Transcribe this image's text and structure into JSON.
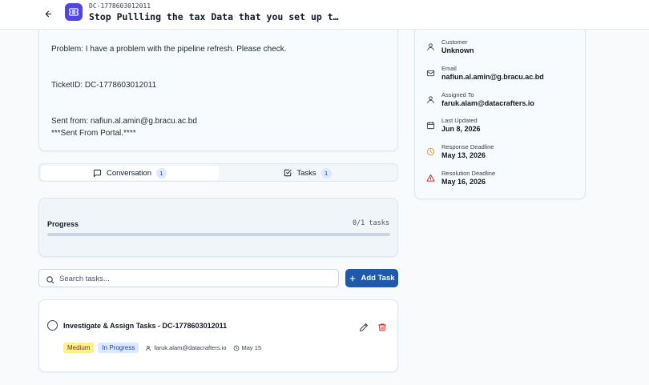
{
  "header": {
    "ticket_id": "DC-1778603012011",
    "title": "Stop Pullling the tax Data that you set up t…"
  },
  "message": {
    "lines": [
      "Problem: I have a problem with the pipeline refresh. Please check.",
      "TicketID: DC-1778603012011",
      "Sent from: nafiun.al.amin@g.bracu.ac.bd",
      "***Sent From Portal.****"
    ]
  },
  "tabs": [
    {
      "label": "Conversation",
      "count": "1",
      "icon": "message-square-icon"
    },
    {
      "label": "Tasks",
      "count": "1",
      "icon": "check-square-icon"
    }
  ],
  "progress": {
    "label": "Progress",
    "count_text": "0/1 tasks",
    "fraction": 0
  },
  "search": {
    "placeholder": "Search tasks...",
    "value": ""
  },
  "add_task": {
    "label": "Add Task"
  },
  "tasks": [
    {
      "title": "Investigate & Assign Tasks - DC-1778603012011",
      "priority": "Medium",
      "status": "In Progress",
      "assignee": "faruk.alam@datacrafters.io",
      "due": "May 15"
    }
  ],
  "details": [
    {
      "label": "Customer",
      "value": "Unknown",
      "icon": "user-icon"
    },
    {
      "label": "Email",
      "value": "nafiun.al.amin@g.bracu.ac.bd",
      "icon": "mail-icon"
    },
    {
      "label": "Assigned To",
      "value": "faruk.alam@datacrafters.io",
      "icon": "user-icon"
    },
    {
      "label": "Last Updated",
      "value": "Jun 8, 2026",
      "icon": "calendar-icon"
    },
    {
      "label": "Response Deadline",
      "value": "May 13, 2026",
      "icon": "clock-icon"
    },
    {
      "label": "Resolution Deadline",
      "value": "May 16, 2026",
      "icon": "alert-triangle-icon"
    }
  ],
  "colors": {
    "accent": "#1e5aa8",
    "ticket_icon": "#4f46e5",
    "response_deadline_icon": "#f59e0b",
    "resolution_deadline_icon": "#dc2626",
    "delete_icon": "#dc2626"
  }
}
